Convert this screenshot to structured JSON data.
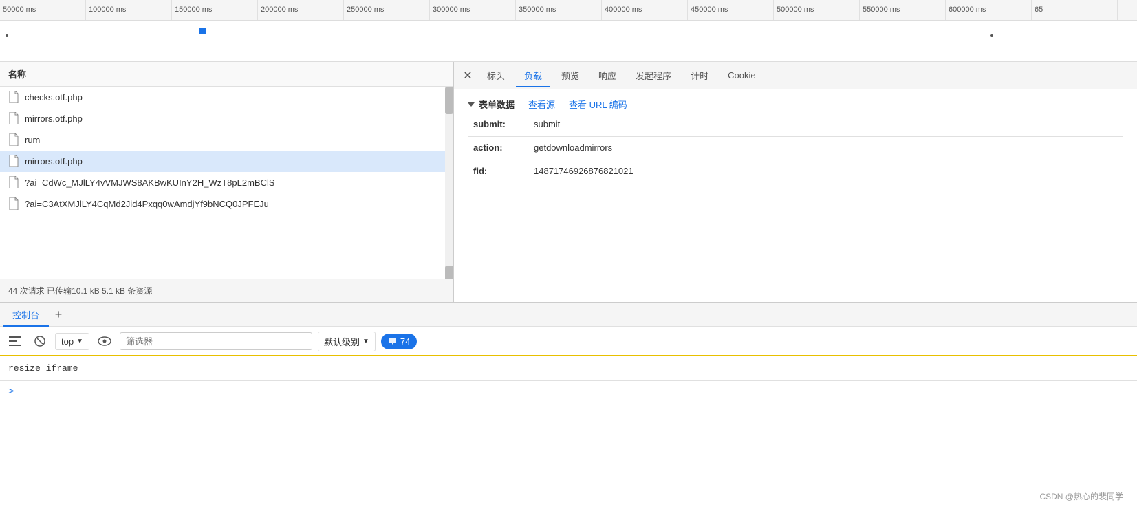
{
  "timeline": {
    "labels": [
      "50000 ms",
      "100000 ms",
      "150000 ms",
      "200000 ms",
      "250000 ms",
      "300000 ms",
      "350000 ms",
      "400000 ms",
      "450000 ms",
      "500000 ms",
      "550000 ms",
      "600000 ms",
      "65"
    ]
  },
  "left_pane": {
    "header": "名称",
    "files": [
      {
        "name": "checks.otf.php",
        "selected": false
      },
      {
        "name": "mirrors.otf.php",
        "selected": false
      },
      {
        "name": "rum",
        "selected": false
      },
      {
        "name": "mirrors.otf.php",
        "selected": true
      },
      {
        "name": "?ai=CdWc_MJlLY4vVMJWS8AKBwKUInY2H_WzT8pL2mBClS",
        "selected": false
      },
      {
        "name": "?ai=C3AtXMJlLY4CqMd2Jid4Pxqq0wAmdjYf9bNCQ0JPFEJu",
        "selected": false
      }
    ],
    "status": "44 次请求  已传输10.1 kB  5.1 kB 条资源"
  },
  "right_pane": {
    "tabs": [
      "标头",
      "负载",
      "预览",
      "响应",
      "发起程序",
      "计时",
      "Cookie"
    ],
    "active_tab": "负载",
    "form_data": {
      "section_title": "表单数据",
      "source_link": "查看源",
      "url_link": "查看 URL 编码",
      "fields": [
        {
          "key": "submit:",
          "value": "submit"
        },
        {
          "key": "action:",
          "value": "getdownloadmirrors"
        },
        {
          "key": "fid:",
          "value": "14871746926876821021"
        }
      ]
    }
  },
  "console": {
    "tabs": [
      "控制台"
    ],
    "add_tab_label": "+",
    "toolbar": {
      "context_label": "top",
      "filter_placeholder": "筛选器",
      "level_label": "默认级别",
      "msg_count": "74"
    },
    "output": {
      "line": "resize iframe"
    },
    "input_prompt": ">"
  },
  "attribution": "CSDN @热心的裴同学"
}
